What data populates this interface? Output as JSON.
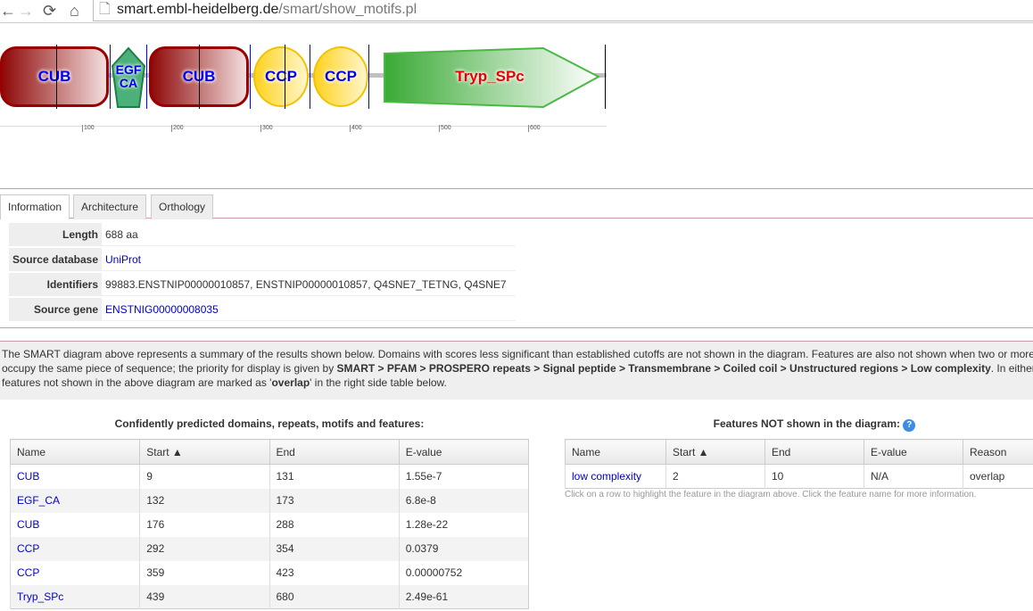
{
  "browser": {
    "url_host": "smart.embl-heidelberg.de",
    "url_path": "/smart/show_motifs.pl"
  },
  "diagram": {
    "domains": [
      {
        "name": "CUB",
        "type": "cub"
      },
      {
        "name": "EGF CA",
        "type": "egf"
      },
      {
        "name": "CUB",
        "type": "cub"
      },
      {
        "name": "CCP",
        "type": "ccp"
      },
      {
        "name": "CCP",
        "type": "ccp"
      },
      {
        "name": "Tryp_SPc",
        "type": "tryp"
      }
    ],
    "ticks": [
      "100",
      "200",
      "300",
      "400",
      "500",
      "600"
    ],
    "colors": {
      "cub": "#990000",
      "ccp": "#ffd21f",
      "egf": "#2e9e5e",
      "tryp": "#3aaa35",
      "label": "#0000ee",
      "tryp_label": "#ee0000"
    }
  },
  "tabs": [
    {
      "label": "Information",
      "active": true
    },
    {
      "label": "Architecture"
    },
    {
      "label": "Orthology"
    }
  ],
  "info": [
    {
      "key": "Length",
      "value": "688 aa"
    },
    {
      "key": "Source database",
      "value": "UniProt",
      "link": true
    },
    {
      "key": "Identifiers",
      "value": "99883.ENSTNIP00000010857, ENSTNIP00000010857, Q4SNE7_TETNG, Q4SNE7"
    },
    {
      "key": "Source gene",
      "value": "ENSTNIG00000008035",
      "link": true
    }
  ],
  "note": {
    "l1": "The SMART diagram above represents a summary of the results shown below. Domains with scores less significant than established cutoffs are not shown in the diagram. Features are also not shown when two or more",
    "l2a": "occupy the same piece of sequence; the priority for display is given by ",
    "l2b": "SMART > PFAM > PROSPERO repeats > Signal peptide > Transmembrane > Coiled coil > Unstructured regions > Low complexity",
    "l2c": ". In either case,",
    "l3a": "features not shown in the above diagram are marked as '",
    "l3b": "overlap",
    "l3c": "' in the right side table below."
  },
  "left_table": {
    "title": "Confidently predicted domains, repeats, motifs and features:",
    "headers": [
      "Name",
      "Start ▲",
      "End",
      "E-value"
    ],
    "rows": [
      [
        "CUB",
        "9",
        "131",
        "1.55e-7"
      ],
      [
        "EGF_CA",
        "132",
        "173",
        "6.8e-8"
      ],
      [
        "CUB",
        "176",
        "288",
        "1.28e-22"
      ],
      [
        "CCP",
        "292",
        "354",
        "0.0379"
      ],
      [
        "CCP",
        "359",
        "423",
        "0.00000752"
      ],
      [
        "Tryp_SPc",
        "439",
        "680",
        "2.49e-61"
      ]
    ]
  },
  "right_table": {
    "title": "Features NOT shown in the diagram:",
    "headers": [
      "Name",
      "Start ▲",
      "End",
      "E-value",
      "Reason"
    ],
    "rows": [
      [
        "low complexity",
        "2",
        "10",
        "N/A",
        "overlap"
      ]
    ],
    "hint": "Click on a row to highlight the feature in the diagram above. Click the feature name for more information."
  }
}
